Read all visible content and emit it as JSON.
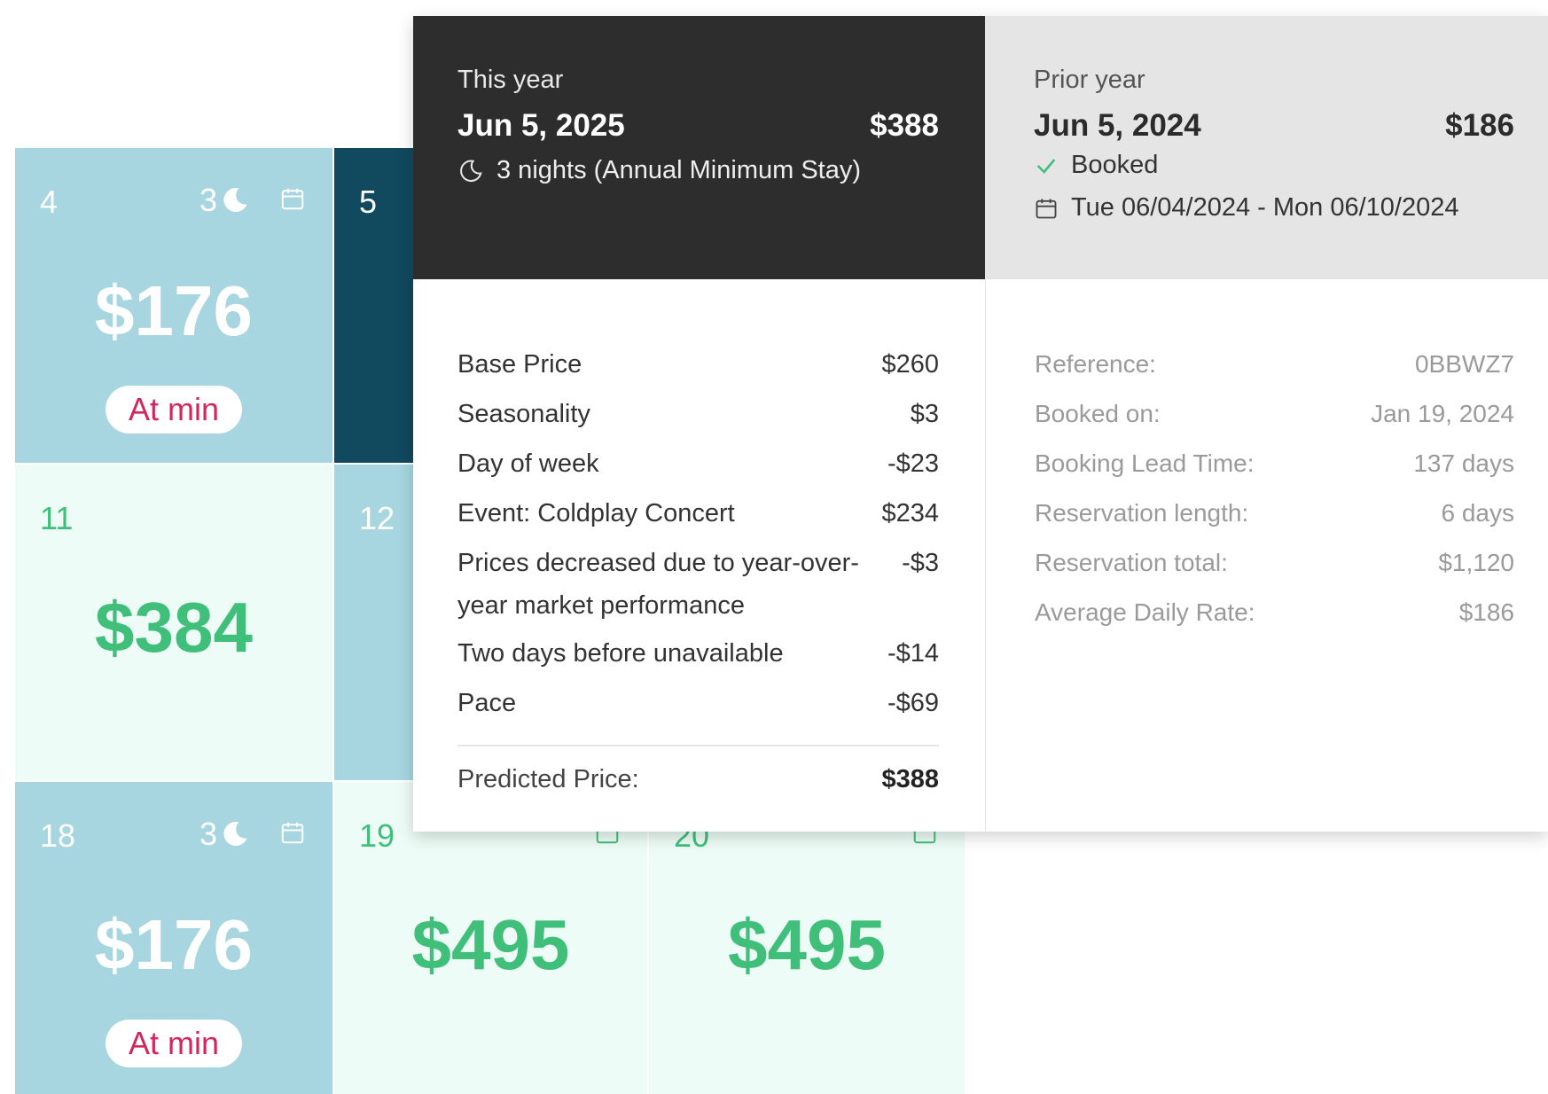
{
  "calendar": {
    "cells": [
      {
        "day": "4",
        "nights": "3",
        "price": "$176",
        "badge": "At min"
      },
      {
        "day": "5"
      },
      {
        "day": "11",
        "price": "$384"
      },
      {
        "day": "12"
      },
      {
        "day": "18",
        "nights": "3",
        "price": "$176",
        "badge": "At min"
      },
      {
        "day": "19",
        "price": "$495"
      },
      {
        "day": "20",
        "price": "$495"
      }
    ]
  },
  "tooltip": {
    "this_year": {
      "label": "This year",
      "date": "Jun 5, 2025",
      "price": "$388",
      "min_stay": "3 nights (Annual Minimum Stay)",
      "breakdown": [
        {
          "label": "Base Price",
          "value": "$260"
        },
        {
          "label": "Seasonality",
          "value": "$3"
        },
        {
          "label": "Day of week",
          "value": "-$23"
        },
        {
          "label": "Event: Coldplay Concert",
          "value": "$234"
        },
        {
          "label": "Prices decreased due to year-over-year market performance",
          "value": "-$3"
        },
        {
          "label": "Two days before unavailable",
          "value": "-$14"
        },
        {
          "label": "Pace",
          "value": "-$69"
        }
      ],
      "predicted_label": "Predicted Price:",
      "predicted_value": "$388"
    },
    "prior_year": {
      "label": "Prior year",
      "date": "Jun 5, 2024",
      "price": "$186",
      "status": "Booked",
      "range": "Tue 06/04/2024 - Mon 06/10/2024",
      "details": [
        {
          "label": "Reference:",
          "value": "0BBWZ7"
        },
        {
          "label": "Booked on:",
          "value": "Jan 19, 2024"
        },
        {
          "label": "Booking Lead Time:",
          "value": "137 days"
        },
        {
          "label": "Reservation length:",
          "value": "6 days"
        },
        {
          "label": "Reservation total:",
          "value": "$1,120"
        },
        {
          "label": "Average Daily Rate:",
          "value": "$186"
        }
      ]
    }
  },
  "colors": {
    "cell_blue": "#a7d6e0",
    "cell_selected": "#11495e",
    "cell_mint": "#edfcf6",
    "price_green": "#3fbf7a",
    "badge_text": "#d2275d",
    "header_dark": "#2d2d2d",
    "header_light": "#e5e5e5",
    "check_green": "#3fbf7a"
  },
  "icons": [
    "moon-icon",
    "calendar-icon",
    "check-icon"
  ]
}
